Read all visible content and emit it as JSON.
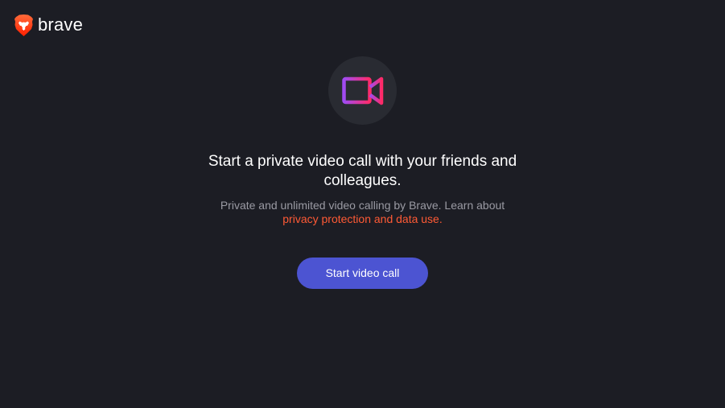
{
  "brand": {
    "name": "brave",
    "logo_icon": "brave-lion-icon",
    "logo_colors": [
      "#fb542b",
      "#ff2000"
    ]
  },
  "hero": {
    "icon": "video-camera-icon",
    "icon_gradient": [
      "#a04bf3",
      "#ff2a67"
    ],
    "circle_color": "#292b32"
  },
  "content": {
    "headline": "Start a private video call with your friends and colleagues.",
    "subtext_prefix": "Private and unlimited video calling by Brave. Learn about ",
    "privacy_link": "privacy protection and data use."
  },
  "cta": {
    "label": "Start video call"
  },
  "colors": {
    "background": "#1c1d24",
    "accent_button": "#4c54d2",
    "link": "#ff5a35",
    "muted_text": "#9a9aa3"
  }
}
